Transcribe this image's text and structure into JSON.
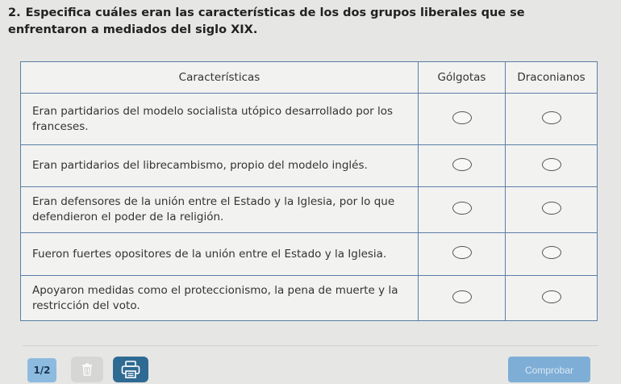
{
  "question": {
    "number": "2.",
    "text": "Especifica cuáles eran las características de los dos grupos liberales que se enfrentaron a mediados del siglo XIX."
  },
  "table": {
    "headers": [
      "Características",
      "Gólgotas",
      "Draconianos"
    ],
    "rows": [
      {
        "text": "Eran partidarios del modelo socialista utópico desarrollado por los franceses."
      },
      {
        "text": "Eran partidarios del librecambismo, propio del modelo inglés."
      },
      {
        "text": "Eran defensores de la unión entre el Estado y la Iglesia, por lo que defendieron el poder de la religión."
      },
      {
        "text": "Fueron fuertes opositores de la unión entre el Estado y la Iglesia."
      },
      {
        "text": "Apoyaron medidas como el proteccionismo, la pena de muerte y la restricción del voto."
      }
    ]
  },
  "footer": {
    "page_indicator": "1/2",
    "trash_icon": "trash-icon",
    "print_icon": "print-icon",
    "check_label": "Comprobar"
  },
  "colors": {
    "table_border": "#5b7fa6",
    "page_indicator_bg": "#8dbbe0",
    "print_button_bg": "#2f6a93",
    "check_button_bg": "#7eaed6"
  }
}
